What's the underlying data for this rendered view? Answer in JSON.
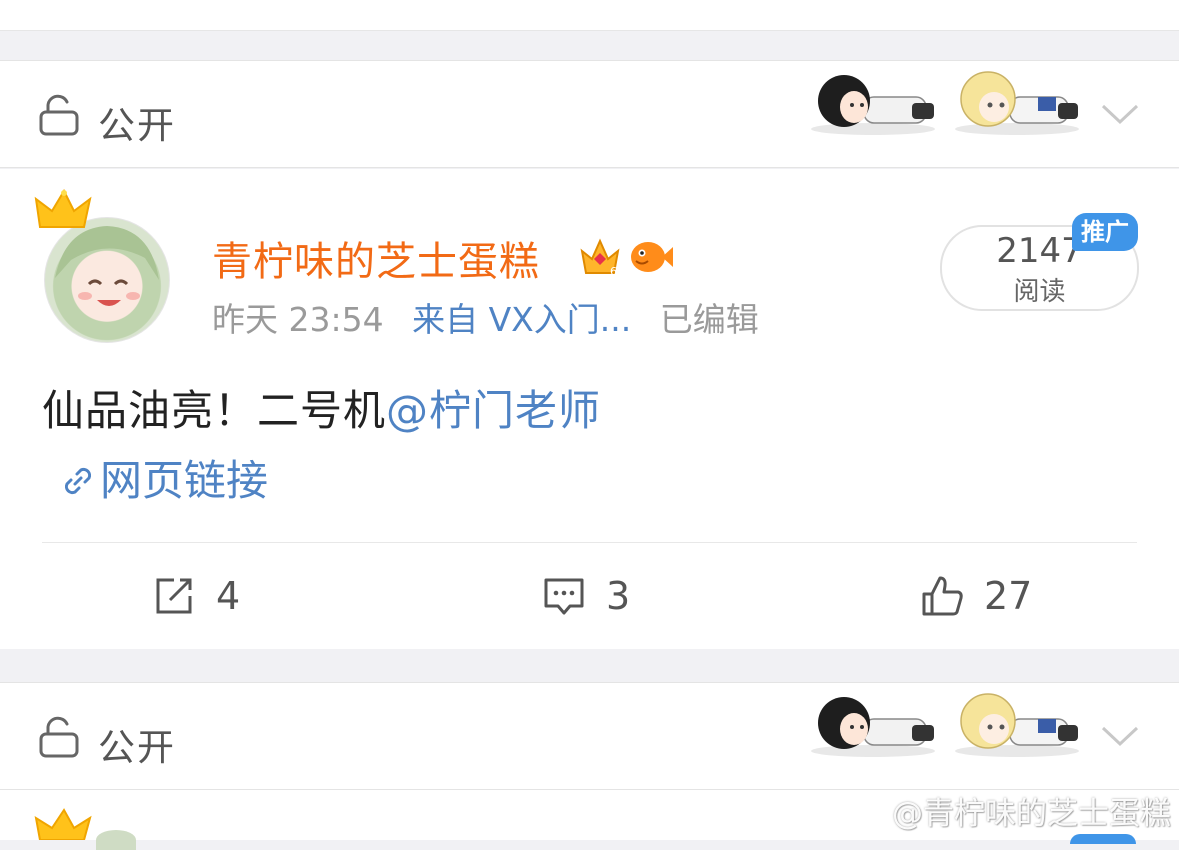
{
  "visibility_bar": {
    "label": "公开"
  },
  "post": {
    "username": "青柠味的芝士蛋糕",
    "time": "昨天 23:54",
    "source": "来自 VX入门...",
    "edited": "已编辑",
    "read_count": "2147",
    "read_label": "阅读",
    "promo_tag": "推广",
    "content_text": "仙品油亮！二号机",
    "mention": "@柠门老师",
    "link_label": "网页链接",
    "actions": {
      "repost_count": "4",
      "comment_count": "3",
      "like_count": "27"
    }
  },
  "watermark": "@青柠味的芝士蛋糕",
  "colors": {
    "username": "#f26a15",
    "link": "#4f83c4",
    "promo": "#3f95e8",
    "background": "#f1f1f4"
  }
}
